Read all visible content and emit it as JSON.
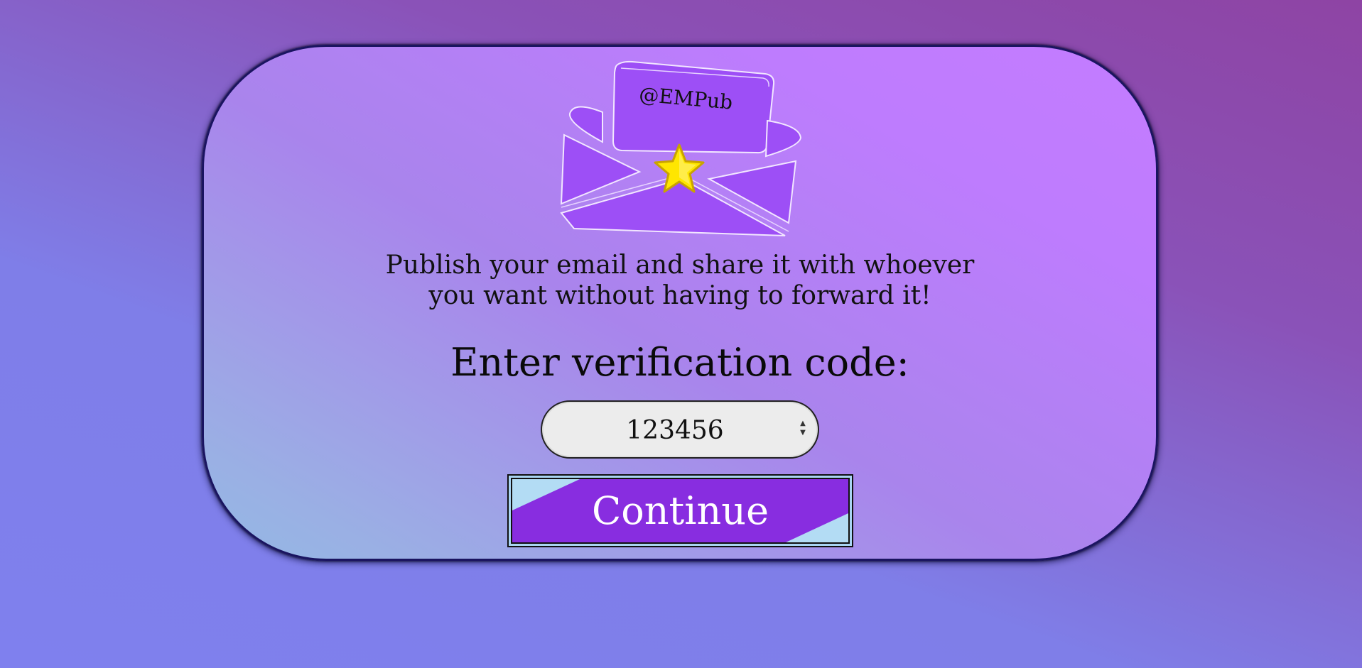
{
  "app": {
    "handle": "@EMPub"
  },
  "tagline": {
    "line1": "Publish your email and share it with whoever",
    "line2": "you want without having to forward it!"
  },
  "verification": {
    "prompt": "Enter verification code:",
    "code_value": "123456",
    "spinner_up": "▲",
    "spinner_down": "▼"
  },
  "actions": {
    "continue_label": "Continue"
  },
  "icons": {
    "logo": "envelope-star-icon"
  },
  "colors": {
    "accent": "#882de0",
    "logo_purple": "#9d4ff6",
    "star": "#ffe600"
  }
}
